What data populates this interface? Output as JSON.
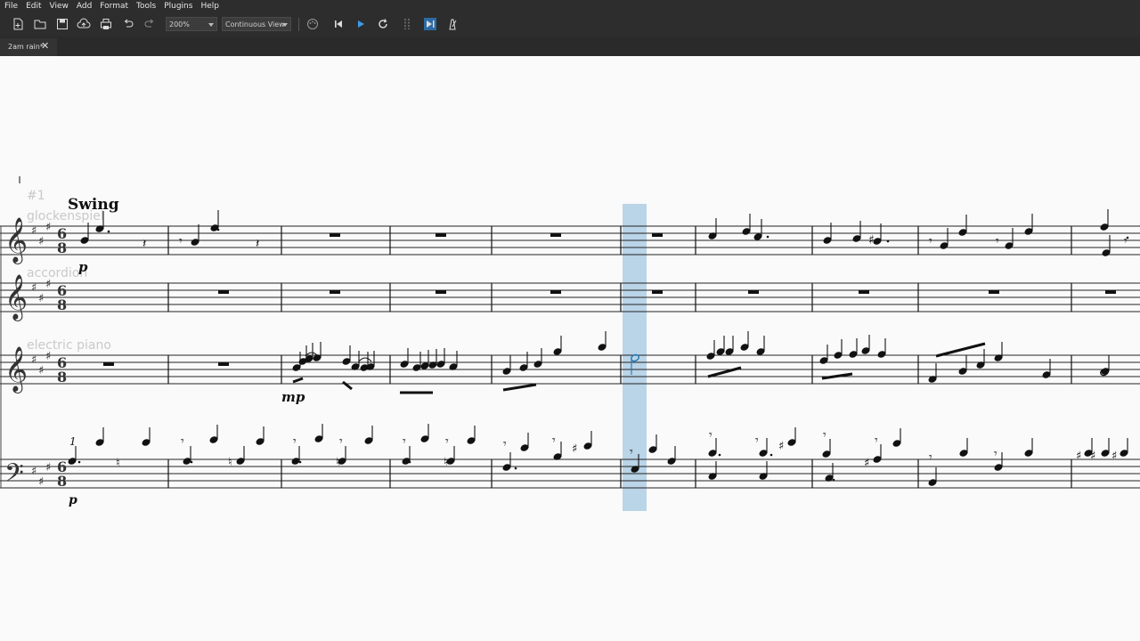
{
  "menu": [
    "File",
    "Edit",
    "View",
    "Add",
    "Format",
    "Tools",
    "Plugins",
    "Help"
  ],
  "toolbar": {
    "zoom": "200%",
    "view_mode": "Continuous View",
    "icons": [
      "new-file-icon",
      "open-folder-icon",
      "save-icon",
      "cloud-upload-icon",
      "print-icon",
      "undo-icon",
      "redo-icon",
      "midi-input-icon",
      "rewind-icon",
      "play-icon",
      "loop-icon",
      "loop-in-out-icon",
      "playback-from-selection-icon",
      "metronome-icon"
    ]
  },
  "tab": {
    "label": "2am rain*",
    "close": "✕"
  },
  "score": {
    "rehearsal_mark": "#1",
    "tempo_text": "Swing",
    "instruments": [
      "glockenspiel",
      "accordion",
      "electric piano"
    ],
    "dynamics": {
      "glock": "p",
      "epiano": "mp",
      "bass": "p"
    },
    "clef_treble": "𝄞",
    "clef_bass": "𝄢",
    "time_sig": "6/8",
    "key_signature": "A major (3 sharps)"
  },
  "colors": {
    "selection": "#6da6d2",
    "note": "#111111",
    "staff_line": "#222222",
    "ghost_text": "#c9c9c9"
  }
}
